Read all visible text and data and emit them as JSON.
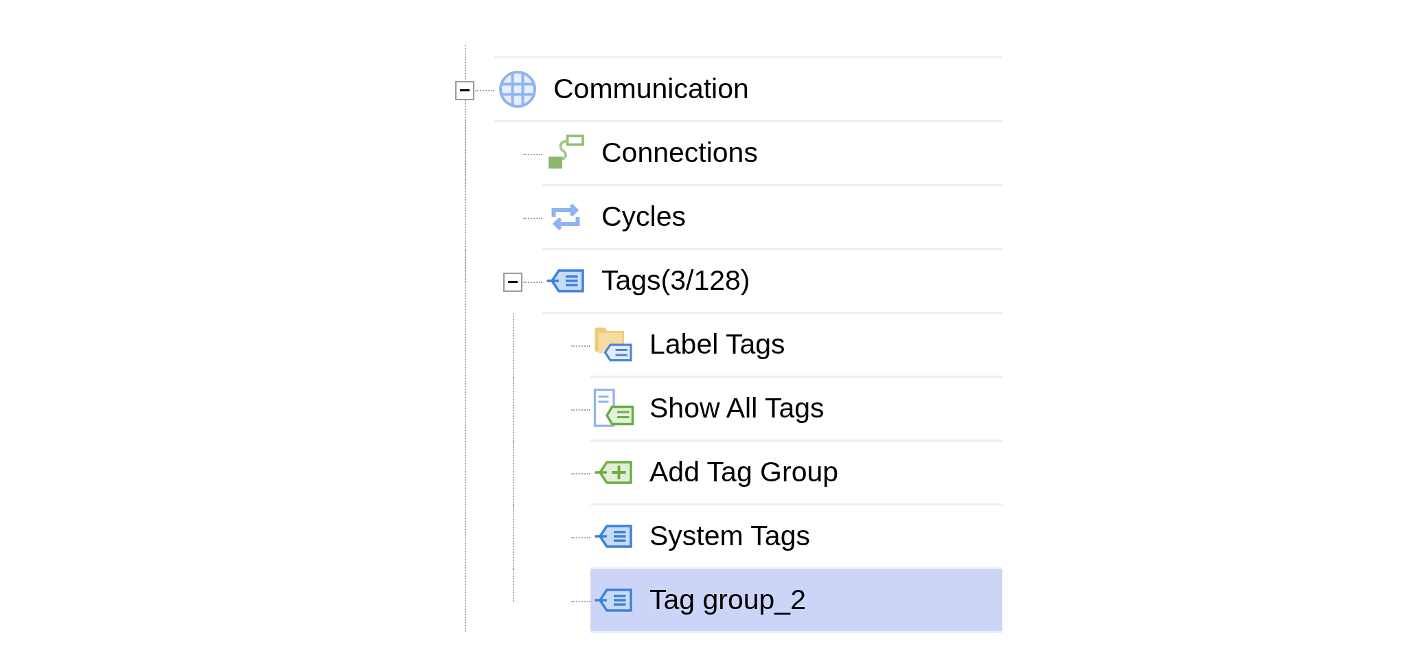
{
  "tree": [
    {
      "label": "Communication",
      "kind": "globe",
      "expanded": true,
      "selected": false,
      "children": [
        {
          "label": "Connections",
          "kind": "connection",
          "selected": false
        },
        {
          "label": "Cycles",
          "kind": "cycle",
          "selected": false
        },
        {
          "label": "Tags(3/128)",
          "kind": "tag",
          "expanded": true,
          "selected": false,
          "children": [
            {
              "label": "Label Tags",
              "kind": "folder",
              "selected": false
            },
            {
              "label": "Show All Tags",
              "kind": "list",
              "selected": false
            },
            {
              "label": "Add Tag Group",
              "kind": "add",
              "selected": false
            },
            {
              "label": "System Tags",
              "kind": "tag",
              "selected": false
            },
            {
              "label": "Tag group_2",
              "kind": "tag",
              "selected": true
            }
          ]
        }
      ]
    }
  ]
}
